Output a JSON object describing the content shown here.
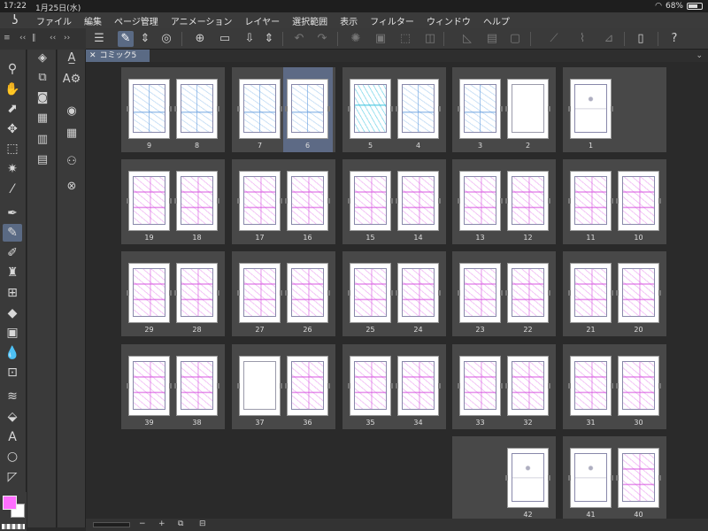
{
  "status": {
    "time": "17:22",
    "date": "1月25日(水)",
    "battery": "68%",
    "battery_fraction": 0.68
  },
  "menu": {
    "logo_icon": "clip-studio-logo-icon",
    "items": [
      "ファイル",
      "編集",
      "ページ管理",
      "アニメーション",
      "レイヤー",
      "選択範囲",
      "表示",
      "フィルター",
      "ウィンドウ",
      "ヘルプ"
    ]
  },
  "toolbar": {
    "icons": [
      "menu-icon",
      "edit-pen-icon",
      "stepper-icon",
      "clip-icon",
      "new-page-icon",
      "open-folder-icon",
      "save-icon",
      "stepper-icon",
      "undo-icon",
      "redo-icon",
      "loading-icon",
      "fill-icon",
      "selection-icon",
      "frame-icon",
      "clear-icon",
      "deselect-icon",
      "pen-icon",
      "brush-icon",
      "eraser-icon",
      "phone-icon",
      "help-icon"
    ]
  },
  "document": {
    "tab_label": "コミック5"
  },
  "spreads": [
    {
      "pages": [
        {
          "num": "9",
          "style": "blue"
        },
        {
          "num": "8",
          "style": "blue"
        }
      ]
    },
    {
      "pages": [
        {
          "num": "7",
          "style": "blue"
        },
        {
          "num": "6",
          "style": "blue"
        }
      ],
      "selected": true
    },
    {
      "pages": [
        {
          "num": "5",
          "style": "cyan"
        },
        {
          "num": "4",
          "style": "blue"
        }
      ]
    },
    {
      "pages": [
        {
          "num": "3",
          "style": "blue"
        },
        {
          "num": "2",
          "style": "blank"
        }
      ]
    },
    {
      "pages": [
        {
          "num": "1",
          "style": "sketch"
        }
      ]
    },
    {
      "pages": [
        {
          "num": "19",
          "style": "pink"
        },
        {
          "num": "18",
          "style": "pink"
        }
      ]
    },
    {
      "pages": [
        {
          "num": "17",
          "style": "pink"
        },
        {
          "num": "16",
          "style": "pink"
        }
      ]
    },
    {
      "pages": [
        {
          "num": "15",
          "style": "pink"
        },
        {
          "num": "14",
          "style": "pink"
        }
      ]
    },
    {
      "pages": [
        {
          "num": "13",
          "style": "pink"
        },
        {
          "num": "12",
          "style": "pink"
        }
      ]
    },
    {
      "pages": [
        {
          "num": "11",
          "style": "pink"
        },
        {
          "num": "10",
          "style": "pink"
        }
      ]
    },
    {
      "pages": [
        {
          "num": "29",
          "style": "pink"
        },
        {
          "num": "28",
          "style": "pink"
        }
      ]
    },
    {
      "pages": [
        {
          "num": "27",
          "style": "pink"
        },
        {
          "num": "26",
          "style": "pink"
        }
      ]
    },
    {
      "pages": [
        {
          "num": "25",
          "style": "pink"
        },
        {
          "num": "24",
          "style": "pink"
        }
      ]
    },
    {
      "pages": [
        {
          "num": "23",
          "style": "pink"
        },
        {
          "num": "22",
          "style": "pink"
        }
      ]
    },
    {
      "pages": [
        {
          "num": "21",
          "style": "pink"
        },
        {
          "num": "20",
          "style": "pink"
        }
      ]
    },
    {
      "pages": [
        {
          "num": "39",
          "style": "pink"
        },
        {
          "num": "38",
          "style": "pink"
        }
      ]
    },
    {
      "pages": [
        {
          "num": "37",
          "style": "blank"
        },
        {
          "num": "36",
          "style": "pink"
        }
      ]
    },
    {
      "pages": [
        {
          "num": "35",
          "style": "pink"
        },
        {
          "num": "34",
          "style": "pink"
        }
      ]
    },
    {
      "pages": [
        {
          "num": "33",
          "style": "pink"
        },
        {
          "num": "32",
          "style": "pink"
        }
      ]
    },
    {
      "pages": [
        {
          "num": "31",
          "style": "pink"
        },
        {
          "num": "30",
          "style": "pink"
        }
      ]
    },
    {
      "pages": [
        {
          "num": "",
          "style": "none"
        },
        {
          "num": "42",
          "style": "sketch"
        }
      ]
    },
    {
      "pages": [
        {
          "num": "41",
          "style": "sketch"
        },
        {
          "num": "40",
          "style": "pink"
        }
      ]
    }
  ],
  "colors": {
    "main": "#ff6fff",
    "sub": "#ffffff",
    "selection": "#5d6a85"
  },
  "bottom": {
    "minus": "−",
    "plus": "+"
  }
}
